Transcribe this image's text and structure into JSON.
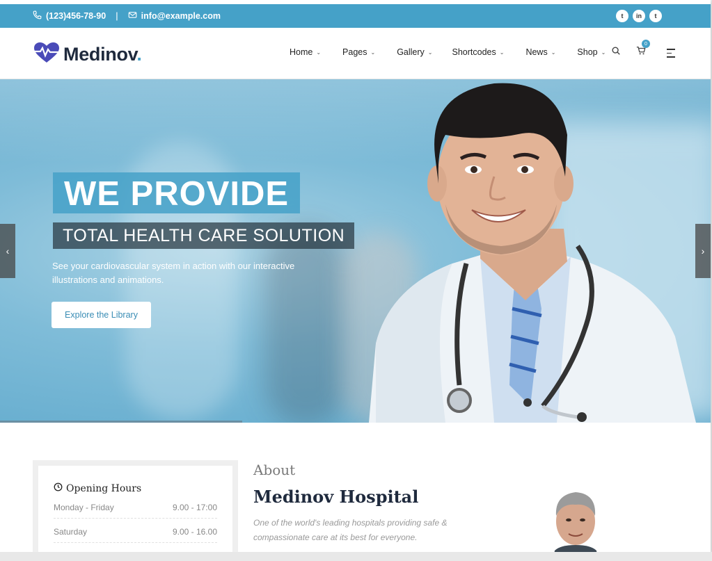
{
  "topbar": {
    "phone": "(123)456-78-90",
    "separator": "|",
    "email": "info@example.com",
    "social": [
      "t",
      "in",
      "t"
    ]
  },
  "header": {
    "brand": "Medinov",
    "brand_dot": ".",
    "nav": [
      "Home",
      "Pages",
      "Gallery",
      "Shortcodes",
      "News",
      "Shop"
    ],
    "cart_count": "0"
  },
  "hero": {
    "title": "WE PROVIDE",
    "subtitle": "TOTAL HEALTH CARE SOLUTION",
    "description": "See your cardiovascular system in action with our interactive illustrations and animations.",
    "button": "Explore the Library",
    "prev": "‹",
    "next": "›"
  },
  "hours": {
    "title": "Opening Hours",
    "rows": [
      {
        "day": "Monday - Friday",
        "time": "9.00 - 17:00"
      },
      {
        "day": "Saturday",
        "time": "9.00 - 16.00"
      }
    ]
  },
  "about": {
    "label": "About",
    "heading": "Medinov Hospital",
    "text": "One of the world's leading hospitals providing safe & compassionate care at its best for everyone."
  },
  "colors": {
    "accent": "#45a1c8",
    "dark": "#1f2a3d"
  }
}
